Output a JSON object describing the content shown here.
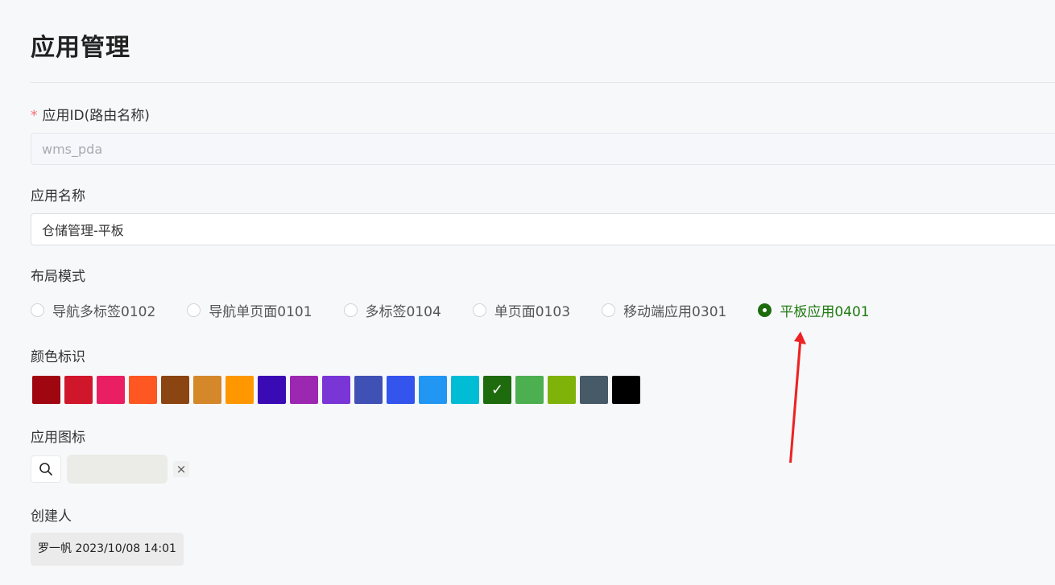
{
  "page": {
    "title": "应用管理"
  },
  "form": {
    "app_id": {
      "label": "应用ID(路由名称)",
      "required_mark": "*",
      "value": "wms_pda"
    },
    "app_name": {
      "label": "应用名称",
      "value": "仓储管理-平板"
    },
    "layout": {
      "label": "布局模式",
      "options": [
        {
          "label": "导航多标签0102",
          "checked": false
        },
        {
          "label": "导航单页面0101",
          "checked": false
        },
        {
          "label": "多标签0104",
          "checked": false
        },
        {
          "label": "单页面0103",
          "checked": false
        },
        {
          "label": "移动端应用0301",
          "checked": false
        },
        {
          "label": "平板应用0401",
          "checked": true
        }
      ]
    },
    "color": {
      "label": "颜色标识",
      "selected_index": 14,
      "check_glyph": "✓",
      "swatches": [
        "#a0060f",
        "#d0162a",
        "#e91e63",
        "#ff5722",
        "#8b4513",
        "#d4882a",
        "#ff9800",
        "#3a0ab5",
        "#9c27b0",
        "#7a35d6",
        "#3f51b5",
        "#3355ee",
        "#2196f3",
        "#00bcd4",
        "#1e6b0e",
        "#4caf50",
        "#80b30a",
        "#475a68",
        "#000000"
      ]
    },
    "icon": {
      "label": "应用图标",
      "search_icon": "search-icon",
      "clear_glyph": "×"
    },
    "creator": {
      "label": "创建人",
      "value": "罗一帆 2023/10/08 14:01"
    }
  },
  "colors": {
    "accent": "#1e6b0e",
    "annotation_arrow": "#ee2222"
  }
}
